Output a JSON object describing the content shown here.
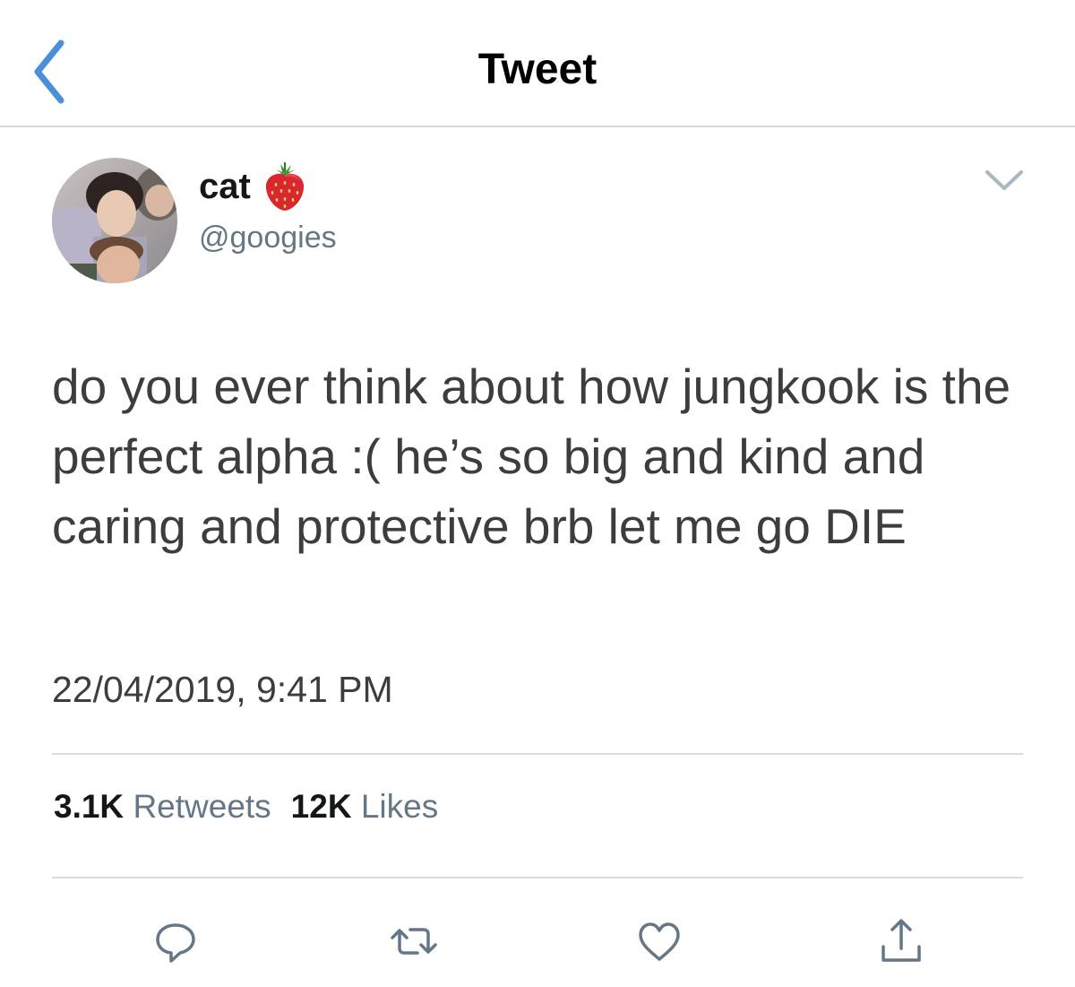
{
  "header": {
    "title": "Tweet",
    "back_icon": "chevron-left-icon"
  },
  "author": {
    "display_name": "cat",
    "name_emoji": "strawberry-icon",
    "handle": "@googies",
    "avatar": "avatar-photo"
  },
  "tweet": {
    "text": "do you ever think about how jungkook is the perfect alpha :( he’s so big and kind and caring and protective brb let me go DIE",
    "timestamp": "22/04/2019, 9:41 PM"
  },
  "stats": {
    "retweets_count": "3.1K",
    "retweets_label": "Retweets",
    "likes_count": "12K",
    "likes_label": "Likes"
  },
  "actions": [
    {
      "name": "reply",
      "icon": "reply-icon"
    },
    {
      "name": "retweet",
      "icon": "retweet-icon"
    },
    {
      "name": "like",
      "icon": "heart-icon"
    },
    {
      "name": "share",
      "icon": "share-icon"
    }
  ],
  "colors": {
    "accent": "#4a90d9",
    "secondary_text": "#657786",
    "icon_gray": "#657786",
    "divider": "#dcdcdc"
  }
}
